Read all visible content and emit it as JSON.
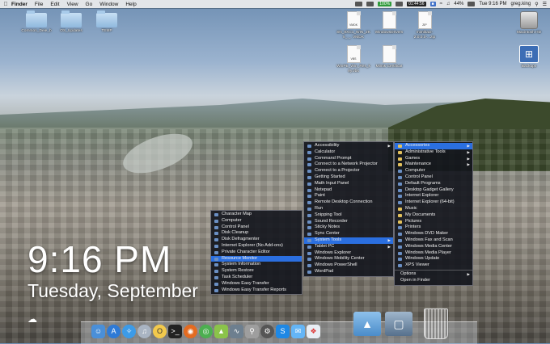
{
  "menubar": {
    "app": "Finder",
    "items": [
      "File",
      "Edit",
      "View",
      "Go",
      "Window",
      "Help"
    ],
    "status": {
      "badge_1": "100%",
      "time_badge": "01:44:56",
      "battery": "44%",
      "clock": "Tue 9:16 PM",
      "user": "greg.king"
    }
  },
  "desktop_icons": [
    {
      "label": "Common_Dele_b",
      "type": "folder"
    },
    {
      "label": "OS_Updates",
      "type": "folder"
    },
    {
      "label": "TEMP",
      "type": "folder"
    },
    {
      "label": "SN_8XC1_WIN_2K8_._. VMDK",
      "type": "doc"
    },
    {
      "label": "WindowsDrivers",
      "type": "doc"
    },
    {
      "label": "mimikatz-2.0.0.0-...zip",
      "type": "doc"
    },
    {
      "label": "Macintosh HD",
      "type": "drive"
    },
    {
      "label": "WinPE_Win_Res_key.vbs",
      "type": "doc"
    },
    {
      "label": "Mimik Certificat",
      "type": "doc"
    },
    {
      "label": "Backups",
      "type": "backup"
    }
  ],
  "widget": {
    "time": "9:16 PM",
    "date": "Tuesday, September"
  },
  "menu_system_tools": [
    "Character Map",
    "Computer",
    "Control Panel",
    "Disk Cleanup",
    "Disk Defragmenter",
    "Internet Explorer (No Add-ons)",
    "Private Character Editor",
    "Resource Monitor",
    "System Information",
    "System Restore",
    "Task Scheduler",
    "Windows Easy Transfer",
    "Windows Easy Transfer Reports"
  ],
  "menu_accessories": [
    "Accessibility",
    "Calculator",
    "Command Prompt",
    "Connect to a Network Projector",
    "Connect to a Projector",
    "Getting Started",
    "Math Input Panel",
    "Notepad",
    "Paint",
    "Remote Desktop Connection",
    "Run",
    "Snipping Tool",
    "Sound Recorder",
    "Sticky Notes",
    "Sync Center",
    "System Tools",
    "Tablet PC",
    "Windows Explorer",
    "Windows Mobility Center",
    "Windows PowerShell",
    "WordPad"
  ],
  "menu_root": [
    "Accessories",
    "Administrative Tools",
    "Games",
    "Maintenance",
    "Computer",
    "Control Panel",
    "Default Programs",
    "Desktop Gadget Gallery",
    "Internet Explorer",
    "Internet Explorer (64-bit)",
    "Music",
    "My Documents",
    "Pictures",
    "Printers",
    "Windows DVD Maker",
    "Windows Fax and Scan",
    "Windows Media Center",
    "Windows Media Player",
    "Windows Update",
    "XPS Viewer",
    "Options",
    "Open in Finder"
  ],
  "dock": {
    "icons": [
      "finder-icon",
      "app-store-icon",
      "safari-icon",
      "itunes-icon",
      "notes-icon",
      "terminal-icon",
      "firefox-icon",
      "chrome-icon",
      "android-icon",
      "activity-icon",
      "keychain-icon",
      "vmware-icon",
      "skype-icon",
      "mail-icon",
      "windows-icon"
    ]
  }
}
